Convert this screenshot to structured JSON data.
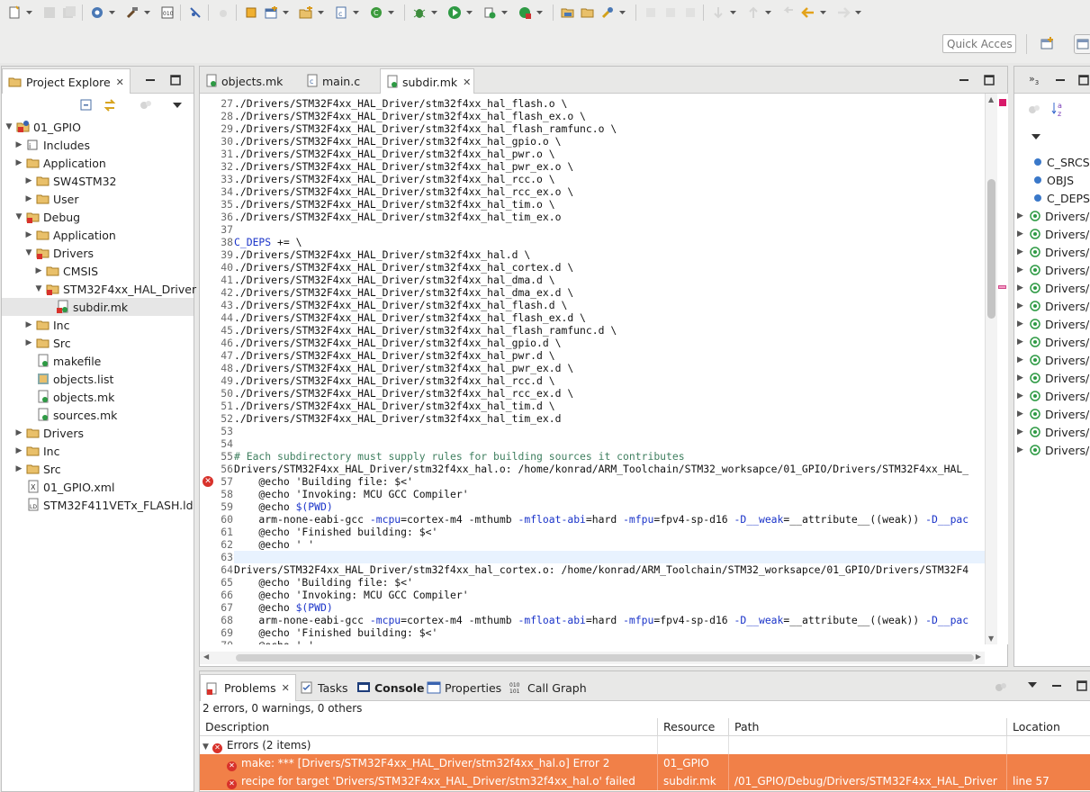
{
  "toolbar": {
    "quick_access_placeholder": "Quick Access"
  },
  "explorer": {
    "tab_label": "Project Explore",
    "tree": [
      {
        "label": "01_GPIO",
        "icon": "project-icon",
        "arrow": "down"
      },
      {
        "label": "Includes",
        "icon": "includes-icon",
        "arrow": "right"
      },
      {
        "label": "Application",
        "icon": "folder-icon",
        "arrow": "right"
      },
      {
        "label": "SW4STM32",
        "icon": "folder-icon",
        "arrow": "right"
      },
      {
        "label": "User",
        "icon": "folder-icon",
        "arrow": "right"
      },
      {
        "label": "Debug",
        "icon": "folder-error-icon",
        "arrow": "down"
      },
      {
        "label": "Application",
        "icon": "folder-icon",
        "arrow": "right"
      },
      {
        "label": "Drivers",
        "icon": "folder-error-icon",
        "arrow": "down"
      },
      {
        "label": "CMSIS",
        "icon": "folder-icon",
        "arrow": "right"
      },
      {
        "label": "STM32F4xx_HAL_Driver",
        "icon": "folder-error-icon",
        "arrow": "down"
      },
      {
        "label": "subdir.mk",
        "icon": "mk-file-error-icon",
        "arrow": ""
      },
      {
        "label": "Inc",
        "icon": "folder-icon",
        "arrow": "right"
      },
      {
        "label": "Src",
        "icon": "folder-icon",
        "arrow": "right"
      },
      {
        "label": "makefile",
        "icon": "file-icon",
        "arrow": ""
      },
      {
        "label": "objects.list",
        "icon": "list-file-icon",
        "arrow": ""
      },
      {
        "label": "objects.mk",
        "icon": "mk-file-icon",
        "arrow": ""
      },
      {
        "label": "sources.mk",
        "icon": "mk-file-icon",
        "arrow": ""
      },
      {
        "label": "Drivers",
        "icon": "folder-icon",
        "arrow": "right"
      },
      {
        "label": "Inc",
        "icon": "folder-icon",
        "arrow": "right"
      },
      {
        "label": "Src",
        "icon": "folder-icon",
        "arrow": "right"
      },
      {
        "label": "01_GPIO.xml",
        "icon": "xml-file-icon",
        "arrow": ""
      },
      {
        "label": "STM32F411VETx_FLASH.ld",
        "icon": "ld-file-icon",
        "arrow": ""
      }
    ]
  },
  "editor": {
    "tabs": [
      {
        "label": "objects.mk",
        "active": false
      },
      {
        "label": "main.c",
        "active": false
      },
      {
        "label": "subdir.mk",
        "active": true
      }
    ],
    "lines": [
      {
        "n": "27",
        "text": "./Drivers/STM32F4xx_HAL_Driver/stm32f4xx_hal_flash.o \\"
      },
      {
        "n": "28",
        "text": "./Drivers/STM32F4xx_HAL_Driver/stm32f4xx_hal_flash_ex.o \\"
      },
      {
        "n": "29",
        "text": "./Drivers/STM32F4xx_HAL_Driver/stm32f4xx_hal_flash_ramfunc.o \\"
      },
      {
        "n": "30",
        "text": "./Drivers/STM32F4xx_HAL_Driver/stm32f4xx_hal_gpio.o \\"
      },
      {
        "n": "31",
        "text": "./Drivers/STM32F4xx_HAL_Driver/stm32f4xx_hal_pwr.o \\"
      },
      {
        "n": "32",
        "text": "./Drivers/STM32F4xx_HAL_Driver/stm32f4xx_hal_pwr_ex.o \\"
      },
      {
        "n": "33",
        "text": "./Drivers/STM32F4xx_HAL_Driver/stm32f4xx_hal_rcc.o \\"
      },
      {
        "n": "34",
        "text": "./Drivers/STM32F4xx_HAL_Driver/stm32f4xx_hal_rcc_ex.o \\"
      },
      {
        "n": "35",
        "text": "./Drivers/STM32F4xx_HAL_Driver/stm32f4xx_hal_tim.o \\"
      },
      {
        "n": "36",
        "text": "./Drivers/STM32F4xx_HAL_Driver/stm32f4xx_hal_tim_ex.o"
      },
      {
        "n": "37",
        "text": ""
      },
      {
        "n": "38",
        "text": "",
        "kw": "C_DEPS",
        "rest": " += \\"
      },
      {
        "n": "39",
        "text": "./Drivers/STM32F4xx_HAL_Driver/stm32f4xx_hal.d \\"
      },
      {
        "n": "40",
        "text": "./Drivers/STM32F4xx_HAL_Driver/stm32f4xx_hal_cortex.d \\"
      },
      {
        "n": "41",
        "text": "./Drivers/STM32F4xx_HAL_Driver/stm32f4xx_hal_dma.d \\"
      },
      {
        "n": "42",
        "text": "./Drivers/STM32F4xx_HAL_Driver/stm32f4xx_hal_dma_ex.d \\"
      },
      {
        "n": "43",
        "text": "./Drivers/STM32F4xx_HAL_Driver/stm32f4xx_hal_flash.d \\"
      },
      {
        "n": "44",
        "text": "./Drivers/STM32F4xx_HAL_Driver/stm32f4xx_hal_flash_ex.d \\"
      },
      {
        "n": "45",
        "text": "./Drivers/STM32F4xx_HAL_Driver/stm32f4xx_hal_flash_ramfunc.d \\"
      },
      {
        "n": "46",
        "text": "./Drivers/STM32F4xx_HAL_Driver/stm32f4xx_hal_gpio.d \\"
      },
      {
        "n": "47",
        "text": "./Drivers/STM32F4xx_HAL_Driver/stm32f4xx_hal_pwr.d \\"
      },
      {
        "n": "48",
        "text": "./Drivers/STM32F4xx_HAL_Driver/stm32f4xx_hal_pwr_ex.d \\"
      },
      {
        "n": "49",
        "text": "./Drivers/STM32F4xx_HAL_Driver/stm32f4xx_hal_rcc.d \\"
      },
      {
        "n": "50",
        "text": "./Drivers/STM32F4xx_HAL_Driver/stm32f4xx_hal_rcc_ex.d \\"
      },
      {
        "n": "51",
        "text": "./Drivers/STM32F4xx_HAL_Driver/stm32f4xx_hal_tim.d \\"
      },
      {
        "n": "52",
        "text": "./Drivers/STM32F4xx_HAL_Driver/stm32f4xx_hal_tim_ex.d"
      },
      {
        "n": "53",
        "text": ""
      },
      {
        "n": "54",
        "text": ""
      },
      {
        "n": "55",
        "text": "",
        "comment": "# Each subdirectory must supply rules for building sources it contributes"
      },
      {
        "n": "56",
        "text": "Drivers/STM32F4xx_HAL_Driver/stm32f4xx_hal.o: /home/konrad/ARM_Toolchain/STM32_worksapce/01_GPIO/Drivers/STM32F4xx_HAL_"
      },
      {
        "n": "57",
        "text": "    @echo 'Building file: $<'",
        "error": true
      },
      {
        "n": "58",
        "text": "    @echo 'Invoking: MCU GCC Compiler'"
      },
      {
        "n": "59",
        "text": "    @echo ",
        "kw": "$(PWD)"
      },
      {
        "n": "60",
        "text": "    arm-none-eabi-gcc ",
        "flags": true
      },
      {
        "n": "61",
        "text": "    @echo 'Finished building: $<'"
      },
      {
        "n": "62",
        "text": "    @echo ' '"
      },
      {
        "n": "63",
        "text": "",
        "highlight": true
      },
      {
        "n": "64",
        "text": "Drivers/STM32F4xx_HAL_Driver/stm32f4xx_hal_cortex.o: /home/konrad/ARM_Toolchain/STM32_worksapce/01_GPIO/Drivers/STM32F4"
      },
      {
        "n": "65",
        "text": "    @echo 'Building file: $<'"
      },
      {
        "n": "66",
        "text": "    @echo 'Invoking: MCU GCC Compiler'"
      },
      {
        "n": "67",
        "text": "    @echo ",
        "kw": "$(PWD)"
      },
      {
        "n": "68",
        "text": "    arm-none-eabi-gcc ",
        "flags": true
      },
      {
        "n": "69",
        "text": "    @echo 'Finished building: $<'"
      },
      {
        "n": "70",
        "text": "    @echo ' '"
      }
    ],
    "gcc_flags": [
      {
        "t": "-mcpu",
        "k": true
      },
      {
        "t": "=cortex-m4 -mthumb ",
        "k": false
      },
      {
        "t": "-mfloat-abi",
        "k": true
      },
      {
        "t": "=hard ",
        "k": false
      },
      {
        "t": "-mfpu",
        "k": true
      },
      {
        "t": "=fpv4-sp-d16 ",
        "k": false
      },
      {
        "t": "-D__weak",
        "k": true
      },
      {
        "t": "=__attribute__((weak)) ",
        "k": false
      },
      {
        "t": "-D__pac",
        "k": true
      }
    ]
  },
  "outline": {
    "items": [
      {
        "label": "C_SRCS",
        "icon": "variable-icon",
        "expandable": false
      },
      {
        "label": "OBJS",
        "icon": "variable-icon",
        "expandable": false
      },
      {
        "label": "C_DEPS",
        "icon": "variable-icon",
        "expandable": false
      },
      {
        "label": "Drivers/S",
        "icon": "rule-icon",
        "expandable": true
      },
      {
        "label": "Drivers/S",
        "icon": "rule-icon",
        "expandable": true
      },
      {
        "label": "Drivers/S",
        "icon": "rule-icon",
        "expandable": true
      },
      {
        "label": "Drivers/S",
        "icon": "rule-icon",
        "expandable": true
      },
      {
        "label": "Drivers/S",
        "icon": "rule-icon",
        "expandable": true
      },
      {
        "label": "Drivers/S",
        "icon": "rule-icon",
        "expandable": true
      },
      {
        "label": "Drivers/S",
        "icon": "rule-icon",
        "expandable": true
      },
      {
        "label": "Drivers/S",
        "icon": "rule-icon",
        "expandable": true
      },
      {
        "label": "Drivers/S",
        "icon": "rule-icon",
        "expandable": true
      },
      {
        "label": "Drivers/S",
        "icon": "rule-icon",
        "expandable": true
      },
      {
        "label": "Drivers/S",
        "icon": "rule-icon",
        "expandable": true
      },
      {
        "label": "Drivers/S",
        "icon": "rule-icon",
        "expandable": true
      },
      {
        "label": "Drivers/S",
        "icon": "rule-icon",
        "expandable": true
      },
      {
        "label": "Drivers/S",
        "icon": "rule-icon",
        "expandable": true
      }
    ]
  },
  "problems": {
    "tabs": [
      {
        "label": "Problems",
        "active": true
      },
      {
        "label": "Tasks",
        "active": false
      },
      {
        "label": "Console",
        "active": false
      },
      {
        "label": "Properties",
        "active": false
      },
      {
        "label": "Call Graph",
        "active": false
      }
    ],
    "summary": "2 errors, 0 warnings, 0 others",
    "columns": [
      "Description",
      "Resource",
      "Path",
      "Location"
    ],
    "group_label": "Errors (2 items)",
    "rows": [
      {
        "description": "make: *** [Drivers/STM32F4xx_HAL_Driver/stm32f4xx_hal.o] Error 2",
        "resource": "01_GPIO",
        "path": "",
        "location": ""
      },
      {
        "description": "recipe for target 'Drivers/STM32F4xx_HAL_Driver/stm32f4xx_hal.o' failed",
        "resource": "subdir.mk",
        "path": "/01_GPIO/Debug/Drivers/STM32F4xx_HAL_Driver",
        "location": "line 57"
      }
    ]
  }
}
